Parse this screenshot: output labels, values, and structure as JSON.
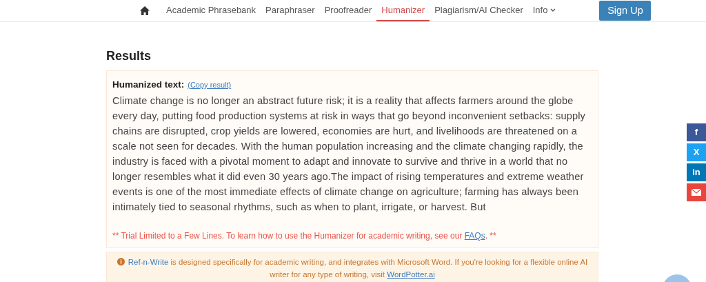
{
  "nav": {
    "items": [
      {
        "label": "Academic Phrasebank",
        "selected": false
      },
      {
        "label": "Paraphraser",
        "selected": false
      },
      {
        "label": "Proofreader",
        "selected": false
      },
      {
        "label": "Humanizer",
        "selected": true
      },
      {
        "label": "Plagiarism/AI Checker",
        "selected": false
      },
      {
        "label": "Info",
        "selected": false,
        "dropdown": true
      }
    ],
    "signup": "Sign Up"
  },
  "results": {
    "title": "Results",
    "label": "Humanized text:",
    "copy_link": "(Copy result)",
    "text": "Climate change is no longer an abstract future risk; it is a reality that affects farmers around the globe every day, putting food production systems at risk in ways that go beyond inconvenient setbacks: supply chains are disrupted, crop yields are lowered, economies are hurt, and livelihoods are threatened on a scale not seen for decades. With the human population increasing and the climate changing rapidly, the industry is faced with a pivotal moment to adapt and innovate to survive and thrive in a world that no longer resembles what it did even 30 years ago.The impact of rising temperatures and extreme weather events is one of the most immediate effects of climate change on agriculture; farming has always been intimately tied to seasonal rhythms, such as when to plant, irrigate, or harvest. But",
    "trial_before": "** Trial Limited to a Few Lines. To learn how to use the Humanizer for academic writing, see our ",
    "trial_link": "FAQs",
    "trial_after": ". **"
  },
  "notice": {
    "link": "Ref-n-Write",
    "text": " is designed specifically for academic writing, and integrates with Microsoft Word. If you're looking for a flexible online AI writer for any type of writing, visit ",
    "link2": "WordPotter.ai"
  },
  "social": [
    {
      "kind": "facebook",
      "glyph": "f"
    },
    {
      "kind": "twitter",
      "glyph": "X"
    },
    {
      "kind": "linkedin",
      "glyph": "in"
    },
    {
      "kind": "email"
    }
  ]
}
